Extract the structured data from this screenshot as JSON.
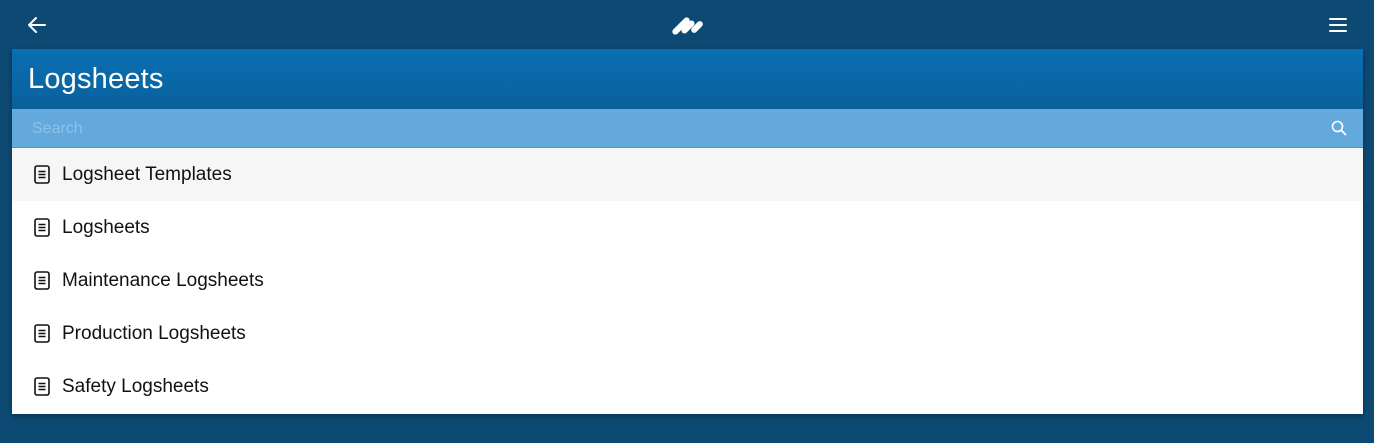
{
  "topbar": {
    "back_icon": "arrow-left-icon",
    "logo_icon": "app-logo-icon",
    "menu_icon": "hamburger-menu-icon"
  },
  "panel": {
    "title": "Logsheets",
    "search": {
      "placeholder": "Search",
      "value": "",
      "icon": "search-icon"
    },
    "items": [
      {
        "label": "Logsheet Templates",
        "icon": "document-icon",
        "active": true
      },
      {
        "label": "Logsheets",
        "icon": "document-icon",
        "active": false
      },
      {
        "label": "Maintenance Logsheets",
        "icon": "document-icon",
        "active": false
      },
      {
        "label": "Production Logsheets",
        "icon": "document-icon",
        "active": false
      },
      {
        "label": "Safety Logsheets",
        "icon": "document-icon",
        "active": false
      }
    ]
  },
  "colors": {
    "background": "#0d4a73",
    "header": "#0a6fb3",
    "search_bar": "#64a9dc",
    "active_row": "#f6f6f6"
  }
}
